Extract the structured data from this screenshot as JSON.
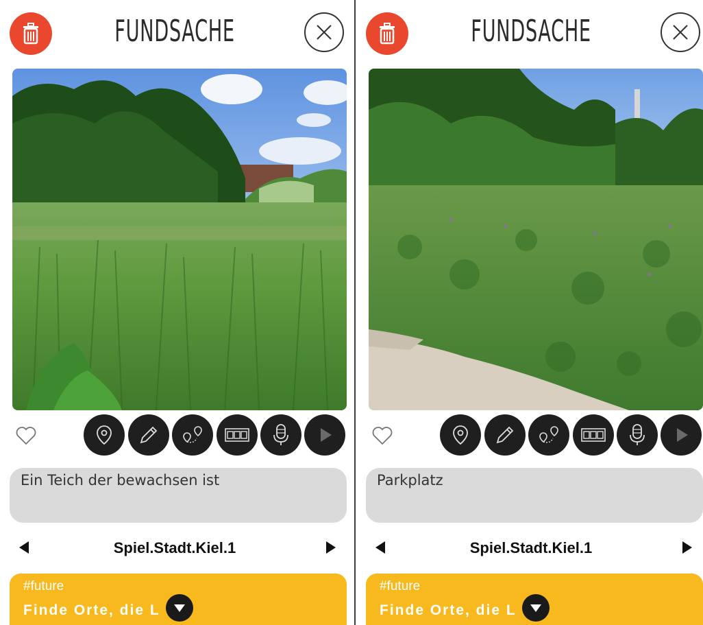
{
  "panels": [
    {
      "title": "FUNDSACHE",
      "description": "Ein Teich der bewachsen ist",
      "project": "Spiel.Stadt.Kiel.1",
      "card": {
        "tag": "#future",
        "headline": "Finde Orte, die L"
      }
    },
    {
      "title": "FUNDSACHE",
      "description": "Parkplatz",
      "project": "Spiel.Stadt.Kiel.1",
      "card": {
        "tag": "#future",
        "headline": "Finde Orte, die L"
      }
    }
  ],
  "colors": {
    "accent_red": "#e9482e",
    "card_yellow": "#f8b91e",
    "text_box": "#dadada",
    "tool_button": "#1f1f1f"
  },
  "icons": [
    "trash-icon",
    "close-icon",
    "heart-icon",
    "location-pin-icon",
    "pencil-icon",
    "route-icon",
    "photo-strip-icon",
    "microphone-icon",
    "play-icon",
    "chevron-down-icon"
  ]
}
